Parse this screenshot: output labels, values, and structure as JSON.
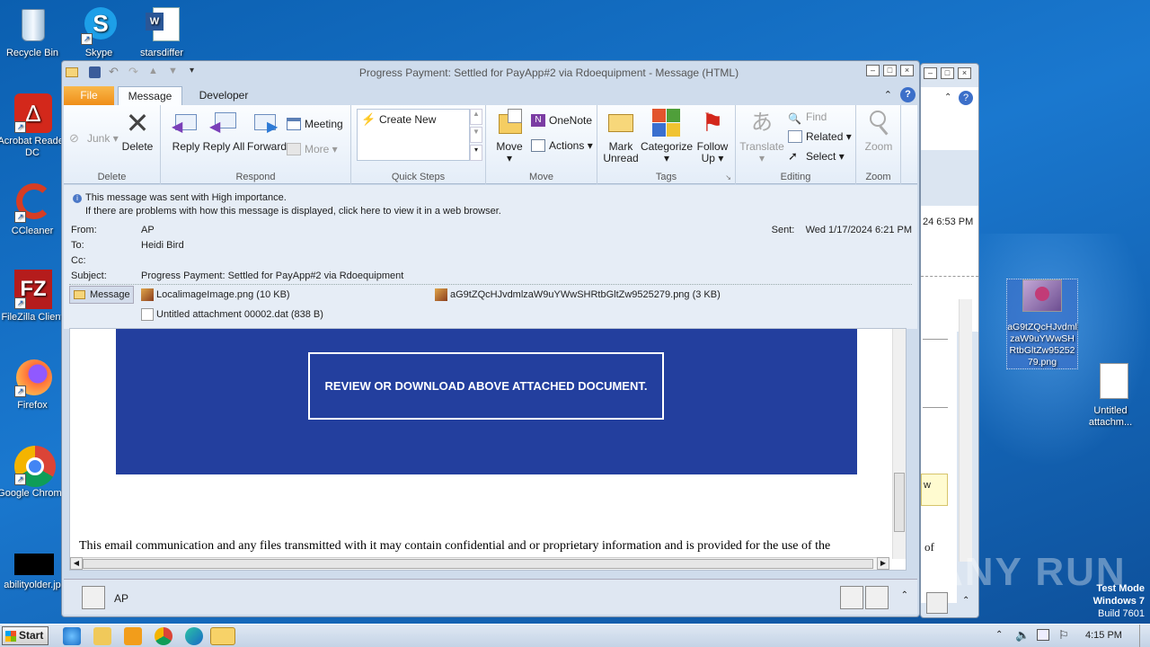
{
  "desktop": {
    "icons": [
      {
        "label": "Recycle Bin"
      },
      {
        "label": "Skype"
      },
      {
        "label": "starsdiffer"
      },
      {
        "label": "Acrobat Reader DC"
      },
      {
        "label": "CCleaner"
      },
      {
        "label": "FileZilla Client"
      },
      {
        "label": "Firefox"
      },
      {
        "label": "Google Chrome"
      },
      {
        "label": "abilityolder.jp"
      }
    ],
    "right_icons": [
      {
        "label": "aG9tZQcHJvdmlzaW9uYWwSHRtbGltZw9525279.png"
      },
      {
        "label": "Untitled attachm..."
      }
    ],
    "watermark": "ANY RUN",
    "mode": {
      "l1": "Test Mode",
      "l2": "Windows 7",
      "l3": "Build 7601"
    }
  },
  "window": {
    "title": "Progress Payment: Settled for PayApp#2 via Rdoequipment  -  Message (HTML)",
    "tabs": [
      "File",
      "Message",
      "Developer"
    ],
    "ribbon": {
      "delete": {
        "junk": "Junk",
        "delete": "Delete",
        "group": "Delete"
      },
      "respond": {
        "reply": "Reply",
        "reply_all": "Reply All",
        "forward": "Forward",
        "meeting": "Meeting",
        "more": "More",
        "group": "Respond"
      },
      "quicksteps": {
        "create_new": "Create New",
        "group": "Quick Steps"
      },
      "move": {
        "move": "Move",
        "onenote": "OneNote",
        "actions": "Actions",
        "group": "Move"
      },
      "tags": {
        "mark_unread": "Mark Unread",
        "categorize": "Categorize",
        "follow_up": "Follow Up",
        "group": "Tags"
      },
      "editing": {
        "translate": "Translate",
        "find": "Find",
        "related": "Related",
        "select": "Select",
        "group": "Editing"
      },
      "zoom": {
        "zoom": "Zoom",
        "group": "Zoom"
      }
    },
    "infobar": {
      "line1": "This message was sent with High importance.",
      "line2": "If there are problems with how this message is displayed, click here to view it in a web browser."
    },
    "headers": {
      "from_label": "From:",
      "from": "AP",
      "to_label": "To:",
      "to": "Heidi Bird",
      "cc_label": "Cc:",
      "subject_label": "Subject:",
      "subject": "Progress Payment: Settled for PayApp#2 via Rdoequipment",
      "sent_label": "Sent:",
      "sent": "Wed 1/17/2024 6:21 PM"
    },
    "attachments": {
      "message_tab": "Message",
      "files": [
        "LocalimageImage.png (10 KB)",
        "aG9tZQcHJvdmlzaW9uYWwSHRtbGltZw9525279.png (3 KB)",
        "Untitled attachment 00002.dat (838 B)"
      ]
    },
    "body": {
      "banner_button": "REVIEW OR DOWNLOAD ABOVE ATTACHED DOCUMENT.",
      "footer": "This email communication and any files transmitted with it may contain confidential and or proprietary information and is provided for the use of the"
    },
    "people": {
      "name": "AP"
    }
  },
  "back_window": {
    "time": "24 6:53 PM",
    "snip": "of"
  },
  "taskbar": {
    "start": "Start",
    "clock": "4:15 PM"
  }
}
